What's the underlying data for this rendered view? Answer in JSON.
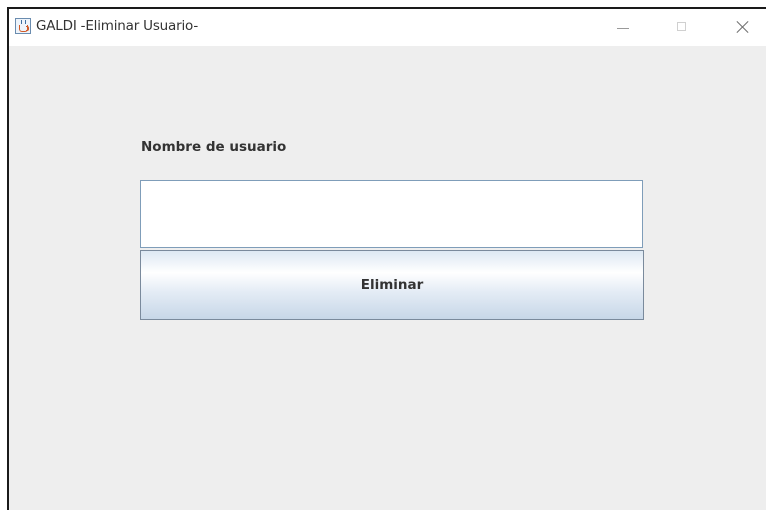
{
  "window": {
    "title": "GALDI -Eliminar Usuario-",
    "icon": "java-app-icon",
    "controls": {
      "minimize_icon": "minimize-icon",
      "maximize_icon": "maximize-icon",
      "close_icon": "close-icon"
    }
  },
  "form": {
    "username_label": "Nombre de usuario",
    "username_value": "",
    "delete_label": "Eliminar"
  },
  "colors": {
    "window_background": "#eeeeee",
    "titlebar_background": "#ffffff",
    "input_border": "#7f9db9",
    "button_gradient_top": "#ffffff",
    "button_gradient_bottom": "#c7d7e8"
  }
}
